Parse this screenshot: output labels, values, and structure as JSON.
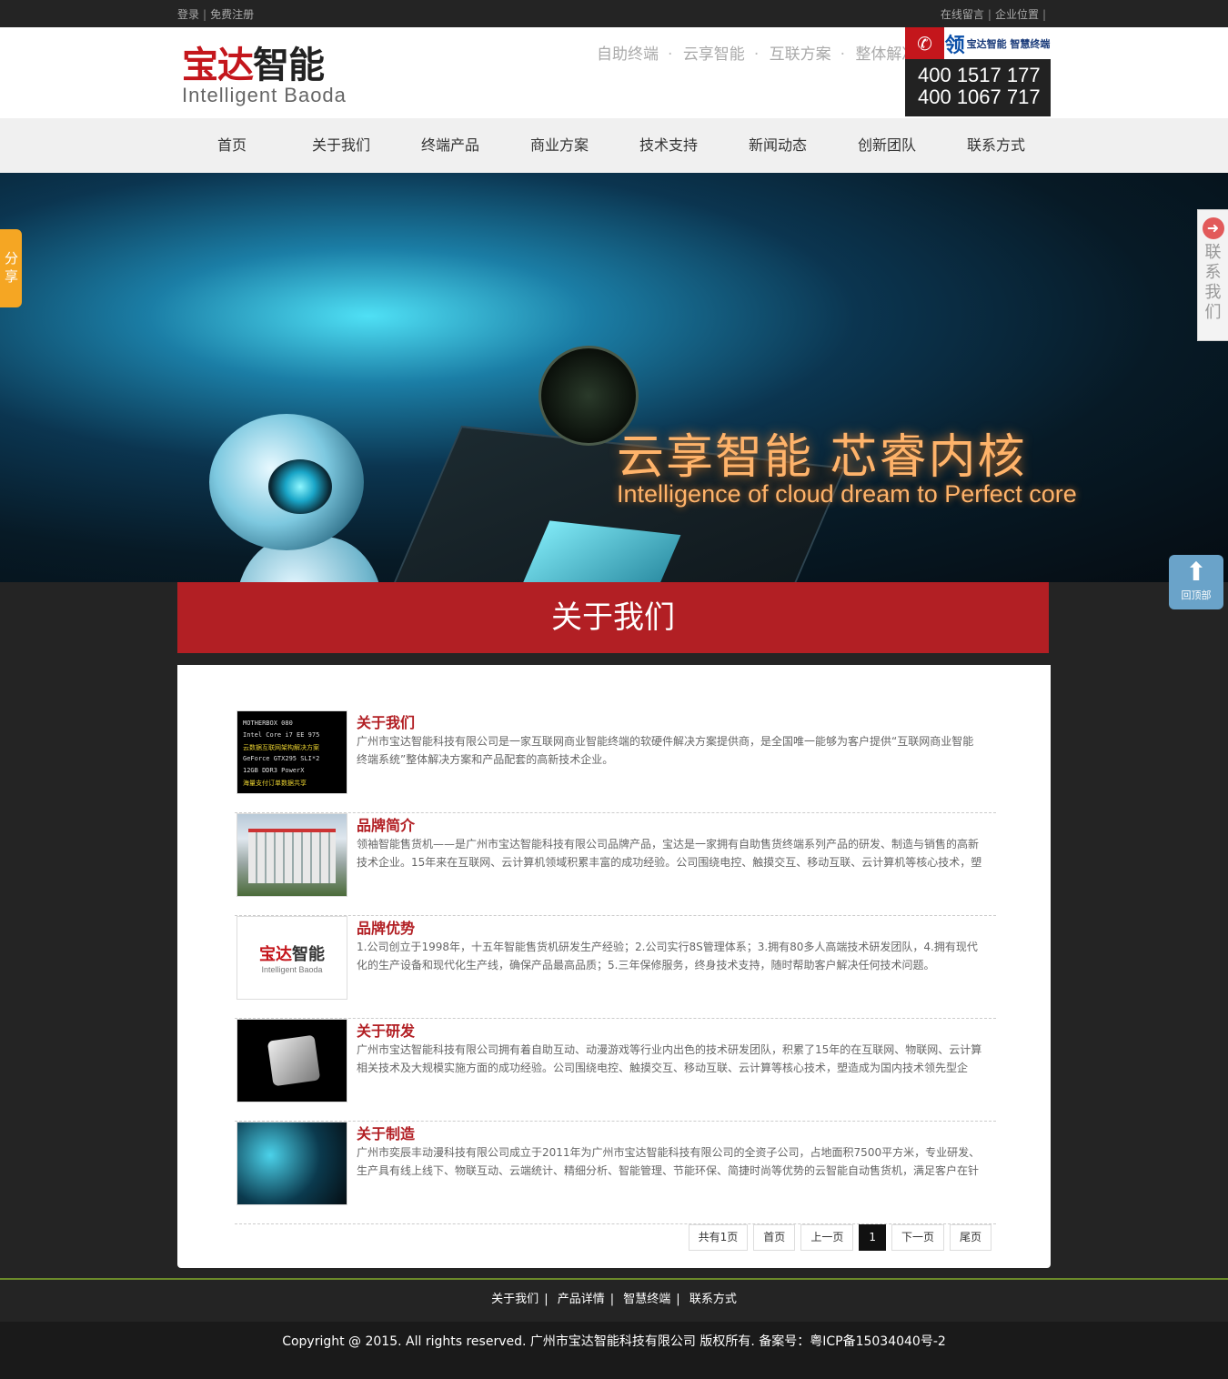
{
  "topbar": {
    "login": "登录",
    "register": "免费注册",
    "message": "在线留言",
    "location": "企业位置"
  },
  "header": {
    "logo_cn_red": "宝达",
    "logo_cn_dark": "智能",
    "logo_en": "Intelligent Baoda",
    "slogan": [
      "自助终端",
      "云享智能",
      "互联方案",
      "整体解决"
    ],
    "brand_big": "领",
    "brand_small": "宝达智能 智慧终端",
    "phones": [
      "400 1517 177",
      "400 1067 717"
    ]
  },
  "nav": {
    "items": [
      "首页",
      "关于我们",
      "终端产品",
      "商业方案",
      "技术支持",
      "新闻动态",
      "创新团队",
      "联系方式"
    ]
  },
  "banner": {
    "tagline": "云享智能  芯睿内核",
    "tagline_en": "Intelligence of cloud dream to Perfect core"
  },
  "section": {
    "title": "关于我们"
  },
  "items": [
    {
      "title": "关于我们",
      "desc": "广州市宝达智能科技有限公司是一家互联网商业智能终端的软硬件解决方案提供商，是全国唯一能够为客户提供“互联网商业智能终端系统”整体解决方案和产品配套的高新技术企业。"
    },
    {
      "title": "品牌简介",
      "desc": "领袖智能售货机——是广州市宝达智能科技有限公司品牌产品，宝达是一家拥有自助售货终端系列产品的研发、制造与销售的高新技术企业。15年来在互联网、云计算机领域积累丰富的成功经验。公司围绕电控、触摸交互、移动互联、云计算机等核心技术，塑"
    },
    {
      "title": "品牌优势",
      "desc": "1.公司创立于1998年，十五年智能售货机研发生产经验；2.公司实行8S管理体系；3.拥有80多人高端技术研发团队，4.拥有现代化的生产设备和现代化生产线，确保产品最高品质；5.三年保修服务，终身技术支持，随时帮助客户解决任何技术问题。"
    },
    {
      "title": "关于研发",
      "desc": "广州市宝达智能科技有限公司拥有着自助互动、动漫游戏等行业内出色的技术研发团队，积累了15年的在互联网、物联网、云计算相关技术及大规模实施方面的成功经验。公司围绕电控、触摸交互、移动互联、云计算等核心技术，塑造成为国内技术领先型企"
    },
    {
      "title": "关于制造",
      "desc": "广州市奕辰丰动漫科技有限公司成立于2011年为广州市宝达智能科技有限公司的全资子公司，占地面积7500平方米，专业研发、生产具有线上线下、物联互动、云端统计、精细分析、智能管理、节能环保、简捷时尚等优势的云智能自动售货机，满足客户在针对"
    }
  ],
  "thumb1_lines": [
    "MOTHERBOX 080",
    "Intel Core i7 EE 975",
    "云数据互联网架构解决方案",
    "GeForce GTX295 SLI*2",
    "12GB DDR3 PowerX",
    "海量支付订单数据共享"
  ],
  "thumb3": {
    "cn_red": "宝达",
    "cn_dark": "智能",
    "en": "Intelligent Baoda"
  },
  "pager": {
    "total": "共有1页",
    "first": "首页",
    "prev": "上一页",
    "current": "1",
    "next": "下一页",
    "last": "尾页"
  },
  "footer": {
    "links": [
      "关于我们",
      "产品详情",
      "智慧终端",
      "联系方式"
    ],
    "copyright": "Copyright @ 2015. All rights reserved.  广州市宝达智能科技有限公司   版权所有.  备案号：粤ICP备15034040号-2"
  },
  "widgets": {
    "share": "分享",
    "contact": "联系我们",
    "backtop": "回顶部"
  },
  "colors": {
    "brand_red": "#b21f24",
    "dark_bg": "#242424",
    "accent_line": "#6b8a2a",
    "share_orange": "#f5a623",
    "backtop_blue": "#6aa3c9"
  }
}
